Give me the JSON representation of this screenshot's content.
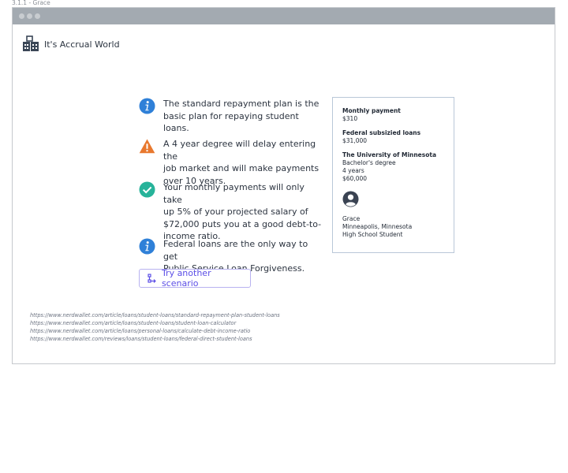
{
  "frame_label": "3.1.1 - Grace",
  "brand": {
    "name": "It's Accrual World",
    "icon": "building-icon"
  },
  "messages": [
    {
      "icon": "info-icon",
      "color": "#2f80d8",
      "text_lines": [
        "The standard repayment plan is the",
        "basic plan for repaying student loans."
      ]
    },
    {
      "icon": "warning-icon",
      "color": "#e8782e",
      "text_lines": [
        "A 4 year degree will delay entering the",
        "job market and will make payments",
        "over 10 years."
      ]
    },
    {
      "icon": "check-icon",
      "color": "#27b39a",
      "text_lines": [
        "Your monthly payments will only take",
        "up 5% of your projected salary of",
        "$72,000 puts you at a good debt-to-",
        "income ratio."
      ]
    },
    {
      "icon": "info-icon",
      "color": "#2f80d8",
      "text_lines": [
        "Federal loans are the only way to get",
        "Public Service Loan Forgiveness."
      ]
    }
  ],
  "scenario_button": {
    "label": "Try another scenario",
    "icon": "scenario-icon",
    "accent": "#5b4ee6"
  },
  "summary": {
    "monthly_payment_label": "Monthly payment",
    "monthly_payment_value": "$310",
    "loans_label": "Federal subsizied loans",
    "loans_value": "$31,000",
    "school_label": "The University of Minnesota",
    "school_lines": [
      "Bachelor's degree",
      "4 years",
      "$60,000"
    ],
    "person_lines": [
      "Grace",
      "Minneapolis, Minnesota",
      "High School Student"
    ]
  },
  "references": [
    "https://www.nerdwallet.com/article/loans/student-loans/standard-repayment-plan-student-loans",
    "https://www.nerdwallet.com/article/loans/student-loans/student-loan-calculator",
    "https://www.nerdwallet.com/article/loans/personal-loans/calculate-debt-income-ratio",
    "https://www.nerdwallet.com/reviews/loans/student-loans/federal-direct-student-loans"
  ]
}
